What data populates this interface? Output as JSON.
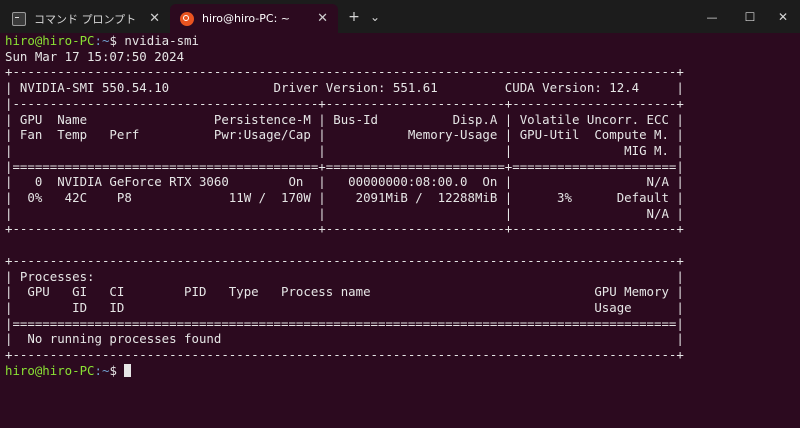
{
  "tabs": [
    {
      "label": "コマンド プロンプト",
      "icon": "cmd-prompt-icon",
      "active": false
    },
    {
      "label": "hiro@hiro-PC: ~",
      "icon": "ubuntu-icon",
      "active": true
    }
  ],
  "window_controls": {
    "new_tab": "+",
    "dropdown": "⌄",
    "minimize": "—",
    "maximize": "☐",
    "close": "✕",
    "tab_close": "✕"
  },
  "terminal": {
    "prompt": {
      "user_host": "hiro@hiro-PC",
      "path": ":~",
      "symbol": "$ "
    },
    "command": "nvidia-smi",
    "date": "Sun Mar 17 15:07:50 2024",
    "smi_lines": [
      "+-----------------------------------------------------------------------------------------+",
      "| NVIDIA-SMI 550.54.10              Driver Version: 551.61         CUDA Version: 12.4     |",
      "|-----------------------------------------+------------------------+----------------------+",
      "| GPU  Name                 Persistence-M | Bus-Id          Disp.A | Volatile Uncorr. ECC |",
      "| Fan  Temp   Perf          Pwr:Usage/Cap |           Memory-Usage | GPU-Util  Compute M. |",
      "|                                         |                        |               MIG M. |",
      "|=========================================+========================+======================|",
      "|   0  NVIDIA GeForce RTX 3060        On  |   00000000:08:00.0  On |                  N/A |",
      "|  0%   42C    P8             11W /  170W |    2091MiB /  12288MiB |      3%      Default |",
      "|                                         |                        |                  N/A |",
      "+-----------------------------------------+------------------------+----------------------+",
      "",
      "+-----------------------------------------------------------------------------------------+",
      "| Processes:                                                                              |",
      "|  GPU   GI   CI        PID   Type   Process name                              GPU Memory |",
      "|        ID   ID                                                               Usage      |",
      "|=========================================================================================|",
      "|  No running processes found                                                             |",
      "+-----------------------------------------------------------------------------------------+"
    ]
  },
  "colors": {
    "terminal_bg": "#2c0a1f",
    "titlebar_bg": "#1c1c1c",
    "prompt_user": "#8ae234",
    "prompt_path": "#729fcf",
    "text": "#e6e6e6"
  }
}
